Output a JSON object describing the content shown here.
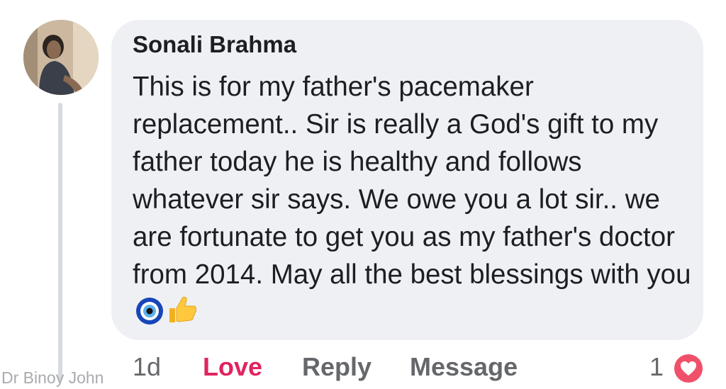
{
  "comment": {
    "author": "Sonali Brahma",
    "text": "This is for my father's pacemaker replacement.. Sir is really a God's gift to my father today he is healthy and follows whatever sir says. We owe you a lot sir.. we are fortunate to get you as my father's doctor from 2014. May all the best blessings with you",
    "emojis": [
      "nazar-amulet-icon",
      "thumbs-up-icon"
    ]
  },
  "actions": {
    "time": "1d",
    "love": "Love",
    "reply": "Reply",
    "message": "Message"
  },
  "reactions": {
    "count": "1",
    "type": "heart-icon"
  },
  "watermark": "Dr Binoy John",
  "colors": {
    "bubble": "#eef0f3",
    "love": "#e0245e",
    "muted": "#65676b",
    "text": "#1c1e21"
  }
}
